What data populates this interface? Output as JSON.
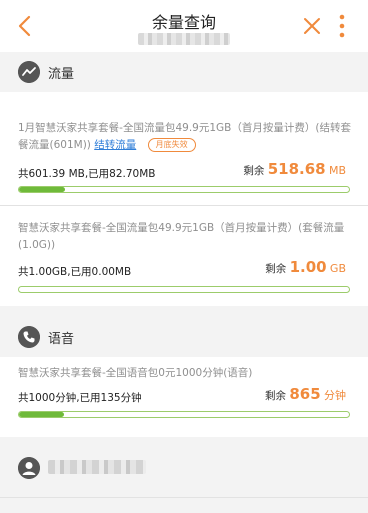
{
  "header": {
    "title": "余量查询"
  },
  "sections": {
    "data": {
      "label": "流量",
      "icon": "chart-icon"
    },
    "voice": {
      "label": "语音",
      "icon": "phone-icon"
    },
    "profile": {
      "icon": "person-icon"
    }
  },
  "packages": [
    {
      "name": "1月智慧沃家共享套餐-全国流量包49.9元1GB（首月按量计费）(结转套餐流量(601M))",
      "link_label": "结转流量",
      "badge_label": "月底失效",
      "usage": "共601.39 MB,已用82.70MB",
      "remain_label": "剩余",
      "remain_value": "518.68",
      "remain_unit": "MB",
      "progress_fraction": 0.14
    },
    {
      "name": "智慧沃家共享套餐-全国流量包49.9元1GB（首月按量计费）(套餐流量(1.0G))",
      "usage": "共1.00GB,已用0.00MB",
      "remain_label": "剩余",
      "remain_value": "1.00",
      "remain_unit": "GB",
      "progress_fraction": 0.0
    },
    {
      "name": "智慧沃家共享套餐-全国语音包0元1000分钟(语音)",
      "usage": "共1000分钟,已用135分钟",
      "remain_label": "剩余",
      "remain_value": "865",
      "remain_unit": "分钟",
      "progress_fraction": 0.135
    }
  ],
  "colors": {
    "accent": "#f08a3c",
    "progress": "#6fba3a",
    "link": "#2f7ed8"
  }
}
